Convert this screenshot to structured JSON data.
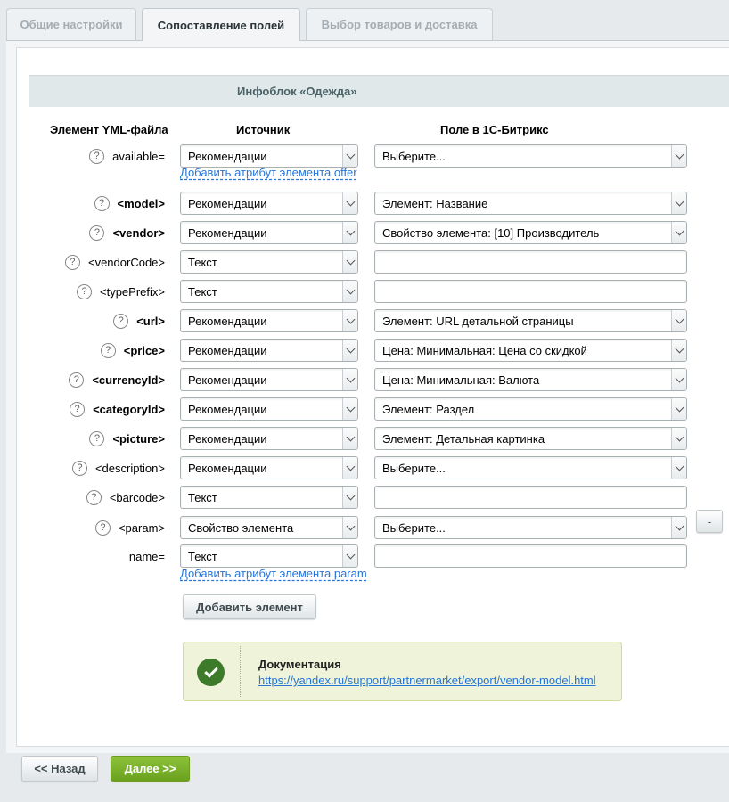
{
  "tabs": [
    {
      "label": "Общие настройки",
      "active": false
    },
    {
      "label": "Сопоставление полей",
      "active": true
    },
    {
      "label": "Выбор товаров и доставка",
      "active": false
    }
  ],
  "iblock_title": "Инфоблок «Одежда»",
  "columns": {
    "element": "Элемент YML-файла",
    "source": "Источник",
    "field": "Поле в 1С-Битрикс"
  },
  "help_glyph": "?",
  "rows": [
    {
      "label": "available=",
      "bold": false,
      "help": true,
      "source": "Рекомендации",
      "field": "Выберите...",
      "field_type": "select"
    },
    {
      "label": "<model>",
      "bold": true,
      "help": true,
      "source": "Рекомендации",
      "field": "Элемент: Название",
      "field_type": "select"
    },
    {
      "label": "<vendor>",
      "bold": true,
      "help": true,
      "source": "Рекомендации",
      "field": "Свойство элемента: [10] Производитель",
      "field_type": "select"
    },
    {
      "label": "<vendorCode>",
      "bold": false,
      "help": true,
      "source": "Текст",
      "field": "",
      "field_type": "input"
    },
    {
      "label": "<typePrefix>",
      "bold": false,
      "help": true,
      "source": "Текст",
      "field": "",
      "field_type": "input"
    },
    {
      "label": "<url>",
      "bold": true,
      "help": true,
      "source": "Рекомендации",
      "field": "Элемент: URL детальной страницы",
      "field_type": "select"
    },
    {
      "label": "<price>",
      "bold": true,
      "help": true,
      "source": "Рекомендации",
      "field": "Цена: Минимальная: Цена со скидкой",
      "field_type": "select"
    },
    {
      "label": "<currencyId>",
      "bold": true,
      "help": true,
      "source": "Рекомендации",
      "field": "Цена: Минимальная: Валюта",
      "field_type": "select"
    },
    {
      "label": "<categoryId>",
      "bold": true,
      "help": true,
      "source": "Рекомендации",
      "field": "Элемент: Раздел",
      "field_type": "select"
    },
    {
      "label": "<picture>",
      "bold": true,
      "help": true,
      "source": "Рекомендации",
      "field": "Элемент: Детальная картинка",
      "field_type": "select"
    },
    {
      "label": "<description>",
      "bold": false,
      "help": true,
      "source": "Рекомендации",
      "field": "Выберите...",
      "field_type": "select"
    },
    {
      "label": "<barcode>",
      "bold": false,
      "help": true,
      "source": "Текст",
      "field": "",
      "field_type": "input"
    },
    {
      "label": "<param>",
      "bold": false,
      "help": true,
      "source": "Свойство элемента",
      "field": "Выберите...",
      "field_type": "select"
    },
    {
      "label": "name=",
      "bold": false,
      "help": false,
      "source": "Текст",
      "field": "",
      "field_type": "input"
    }
  ],
  "links": {
    "add_offer_attr": "Добавить атрибут элемента offer",
    "add_param_attr": "Добавить атрибут элемента param"
  },
  "remove_button": "-",
  "add_element_button": "Добавить элемент",
  "doc": {
    "title": "Документация",
    "url": "https://yandex.ru/support/partnermarket/export/vendor-model.html"
  },
  "footer": {
    "back": "<< Назад",
    "next": "Далее >>"
  },
  "colors": {
    "accent_link": "#2675d7",
    "next_button": "#7ab02b",
    "doc_bg": "#eef3d9"
  }
}
